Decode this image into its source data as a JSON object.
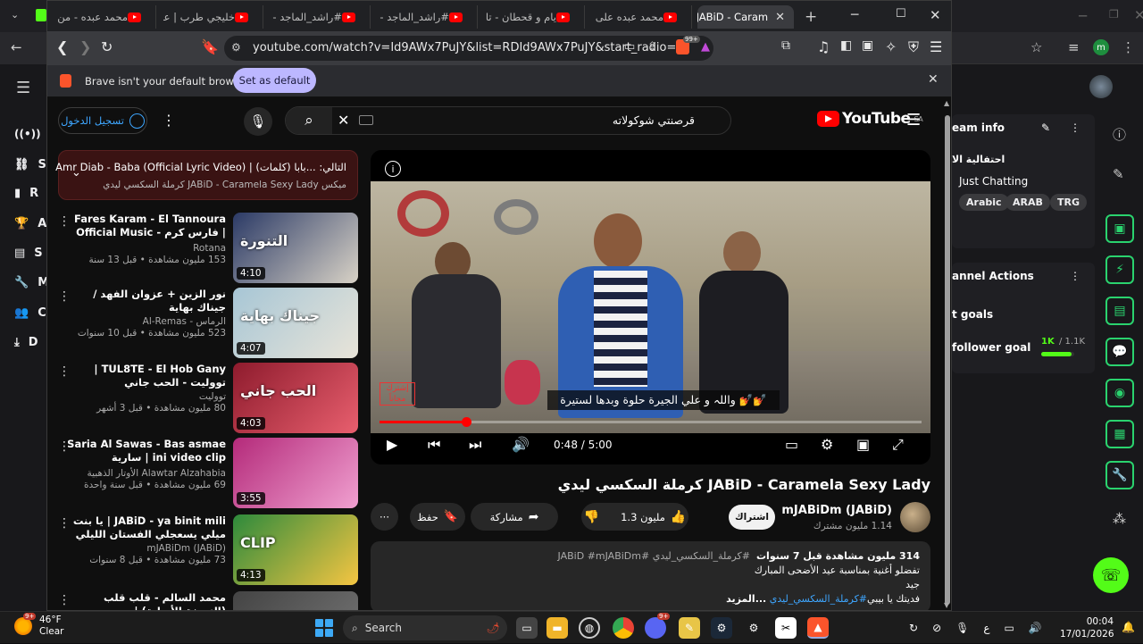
{
  "browser": {
    "tabs": [
      {
        "title": "محمد عبده - من بـا",
        "active": false
      },
      {
        "title": "خليجي طرب | عيني",
        "active": false
      },
      {
        "title": "#راشد_الماجد - أحـ",
        "active": false
      },
      {
        "title": "#راشد_الماجد - تحـ",
        "active": false
      },
      {
        "title": "يام و قحطان - تاجـ",
        "active": false
      },
      {
        "title": "محمد عبده على الـ",
        "active": false
      },
      {
        "title": "JABiD - Caram",
        "active": true
      }
    ],
    "new_tab_symbol": "+",
    "address": "youtube.com/watch?v=Id9AWx7PuJY&list=RDId9AWx7PuJY&start_radio=1",
    "brave_badge": "99+",
    "infobar_message": "Brave isn't your default browser",
    "infobar_button": "Set as default"
  },
  "youtube": {
    "sign_in": "تسجيل الدخول",
    "search_query": "قرصنتي شوكولاته",
    "logo_text": "YouTube",
    "logo_region": "SA",
    "playlist": {
      "next_label": "التالي: ...بابا (كلمات) | Amr Diab - Baba (Official Lyric Video)",
      "mix_label": "ميكس JABiD - Caramela Sexy Lady كرملة السكسي ليدي"
    },
    "recommendations": [
      {
        "title": "Fares Karam - El Tannoura | فارس كرم - Official Music Video |...",
        "channel": "Rotana",
        "meta": "153 مليون مشاهدة • قبل 13 سنة",
        "duration": "4:10",
        "thumb_text": "التنورة",
        "thumb_colors": [
          "#2b3a66",
          "#d8d2c6"
        ]
      },
      {
        "title": "نور الزين + عزوان الفهد / جيناك بهاية",
        "channel": "الرماس - Al-Remas",
        "meta": "523 مليون مشاهدة • قبل 10 سنوات",
        "duration": "4:07",
        "thumb_text": "جيناك بهاية",
        "thumb_colors": [
          "#a7c6d6",
          "#e8e4d8"
        ]
      },
      {
        "title": "TUL8TE - El Hob Gany | تووليت - الحب جاني",
        "channel": "تووليت",
        "meta": "80 مليون مشاهدة • قبل 3 أشهر",
        "duration": "4:03",
        "thumb_text": "الحب جاني",
        "thumb_colors": [
          "#8e1b2d",
          "#e85f6e"
        ]
      },
      {
        "title": "Saria Al Sawas - Bas asmae ini video clip | سارية السواس - بس",
        "channel": "Alawtar Alzahabia الأوتار الذهبية",
        "meta": "69 مليون مشاهدة • قبل سنة واحدة",
        "duration": "3:55",
        "thumb_text": "",
        "thumb_colors": [
          "#b42a7a",
          "#f0a0d0"
        ]
      },
      {
        "title": "JABiD - ya binit mili | يا بنت ميلي يسعجلي الفستان الليلي",
        "channel": "mJABiDm (JABiD)",
        "meta": "73 مليون مشاهدة • قبل 8 سنوات",
        "duration": "4:13",
        "thumb_text": "CLIP",
        "thumb_colors": [
          "#2d8a3c",
          "#f5c542"
        ]
      },
      {
        "title": "محمد السالم - قلب قلب (النسخة الأصلية) |",
        "channel": "",
        "meta": "",
        "duration": "",
        "thumb_text": "",
        "thumb_colors": [
          "#444",
          "#777"
        ]
      }
    ],
    "player": {
      "subtitle": "💅💅 واللہ و علي الجيرة حلوة وبدها لستيرة",
      "watermark": "إشترك مجاناً",
      "time": "0:48 / 5:00",
      "progress": 0.16
    },
    "video": {
      "title": "JABiD - Caramela Sexy Lady كرملة السكسي ليدي",
      "channel": "mJABiDm (JABiD)",
      "subscribers": "1.14 مليون مشترك",
      "subscribe": "اشتراك",
      "likes": "1.3 مليون",
      "share": "مشاركة",
      "save": "حفظ"
    },
    "description": {
      "stats": "314 مليون مشاهدة  قبل 7 سنوات",
      "hashtags": "#كرملة_السكسي_ليدي #JABiD #mJABiDm",
      "line2": "تفضلو أغنية بمناسبة عيد الأضحى المبارك",
      "line3": "جيد",
      "line4_prefix": "فديتك يا بيبي",
      "line4_link": "#كرملة_السكسي_ليدي",
      "more": "...المزيد"
    }
  },
  "background_window": {
    "left_nav": [
      "S",
      "S",
      "R",
      "A",
      "S",
      "M",
      "C",
      "D"
    ],
    "stream_info_title": "eam info",
    "stream_category_label": "احتفالية الا",
    "stream_category": "Just Chatting",
    "tags": [
      "Arabic",
      "ARAB",
      "TRG"
    ],
    "channel_actions": "annel Actions",
    "goals_label": "t goals",
    "follower_goal": "follower goal",
    "goal_current": "1K",
    "goal_target": "/ 1.1K",
    "goal_progress": 0.91
  },
  "taskbar": {
    "weather_temp": "46°F",
    "weather_desc": "Clear",
    "weather_badge": "9+",
    "search_placeholder": "Search",
    "discord_badge": "9+",
    "lang": "ع",
    "time": "00:04",
    "date": "17/01/2026"
  }
}
